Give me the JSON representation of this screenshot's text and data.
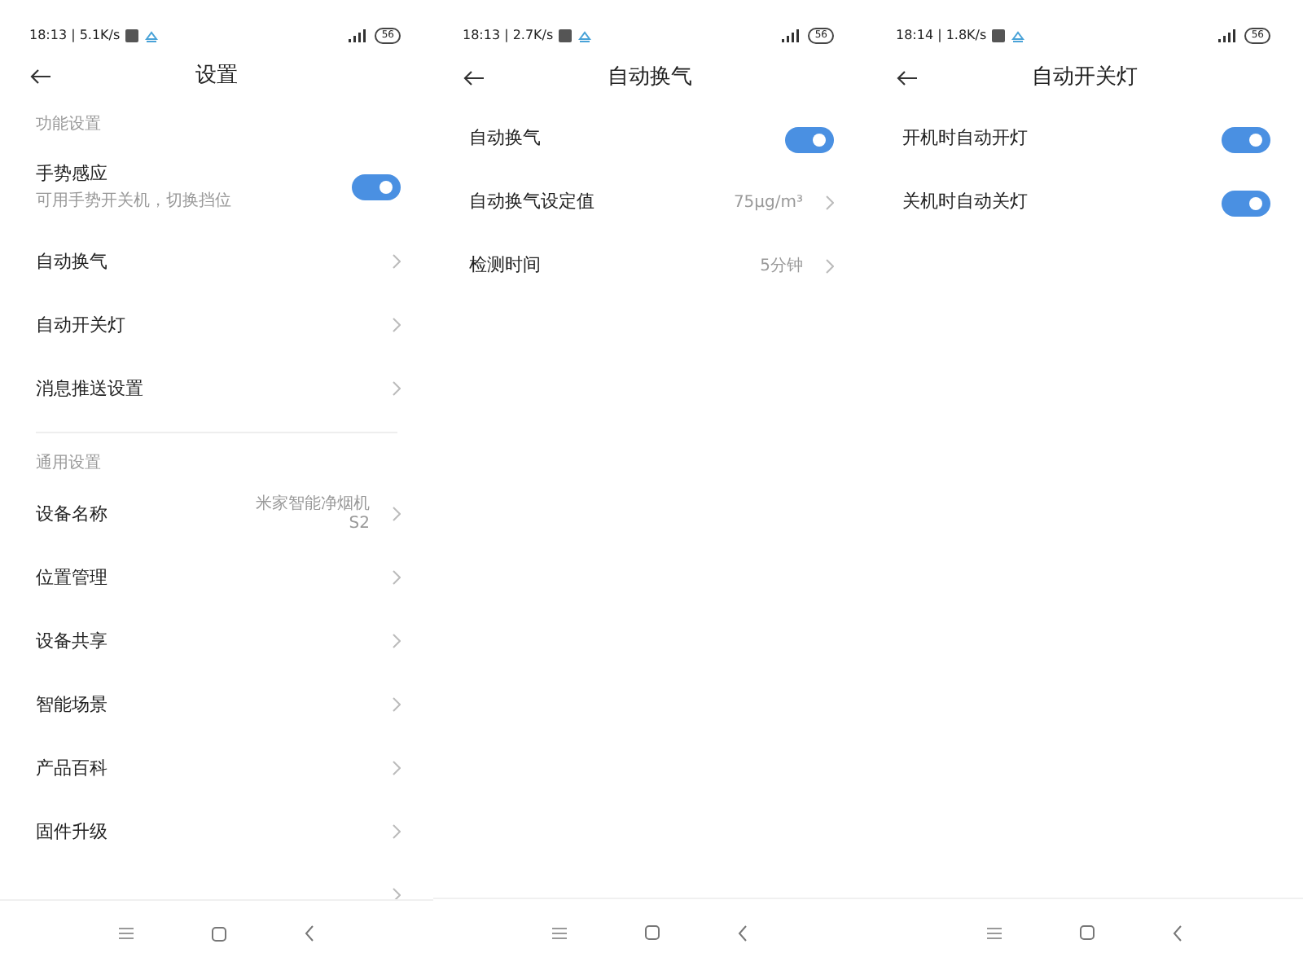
{
  "screens": [
    {
      "status": {
        "time_speed": "18:13 | 5.1K/s",
        "battery": "56"
      },
      "title": "设置",
      "sections": [
        {
          "heading": "功能设置",
          "rows": [
            {
              "kind": "toggle",
              "label": "手势感应",
              "sublabel": "可用手势开关机，切换挡位",
              "on": true
            },
            {
              "kind": "link",
              "label": "自动换气"
            },
            {
              "kind": "link",
              "label": "自动开关灯"
            },
            {
              "kind": "link",
              "label": "消息推送设置"
            }
          ]
        },
        {
          "heading": "通用设置",
          "rows": [
            {
              "kind": "link",
              "label": "设备名称",
              "value": "米家智能净烟机 S2"
            },
            {
              "kind": "link",
              "label": "位置管理"
            },
            {
              "kind": "link",
              "label": "设备共享"
            },
            {
              "kind": "link",
              "label": "智能场景"
            },
            {
              "kind": "link",
              "label": "产品百科"
            },
            {
              "kind": "link",
              "label": "固件升级"
            },
            {
              "kind": "link"
            }
          ]
        }
      ]
    },
    {
      "status": {
        "time_speed": "18:13 | 2.7K/s",
        "battery": "56"
      },
      "title": "自动换气",
      "sections": [
        {
          "rows": [
            {
              "kind": "toggle",
              "label": "自动换气",
              "on": true
            },
            {
              "kind": "link",
              "label": "自动换气设定值",
              "value": "75μg/m³"
            },
            {
              "kind": "link",
              "label": "检测时间",
              "value": "5分钟"
            }
          ]
        }
      ]
    },
    {
      "status": {
        "time_speed": "18:14 | 1.8K/s",
        "battery": "56"
      },
      "title": "自动开关灯",
      "sections": [
        {
          "rows": [
            {
              "kind": "toggle",
              "label": "开机时自动开灯",
              "on": true
            },
            {
              "kind": "toggle",
              "label": "关机时自动关灯",
              "on": true
            }
          ]
        }
      ]
    }
  ]
}
